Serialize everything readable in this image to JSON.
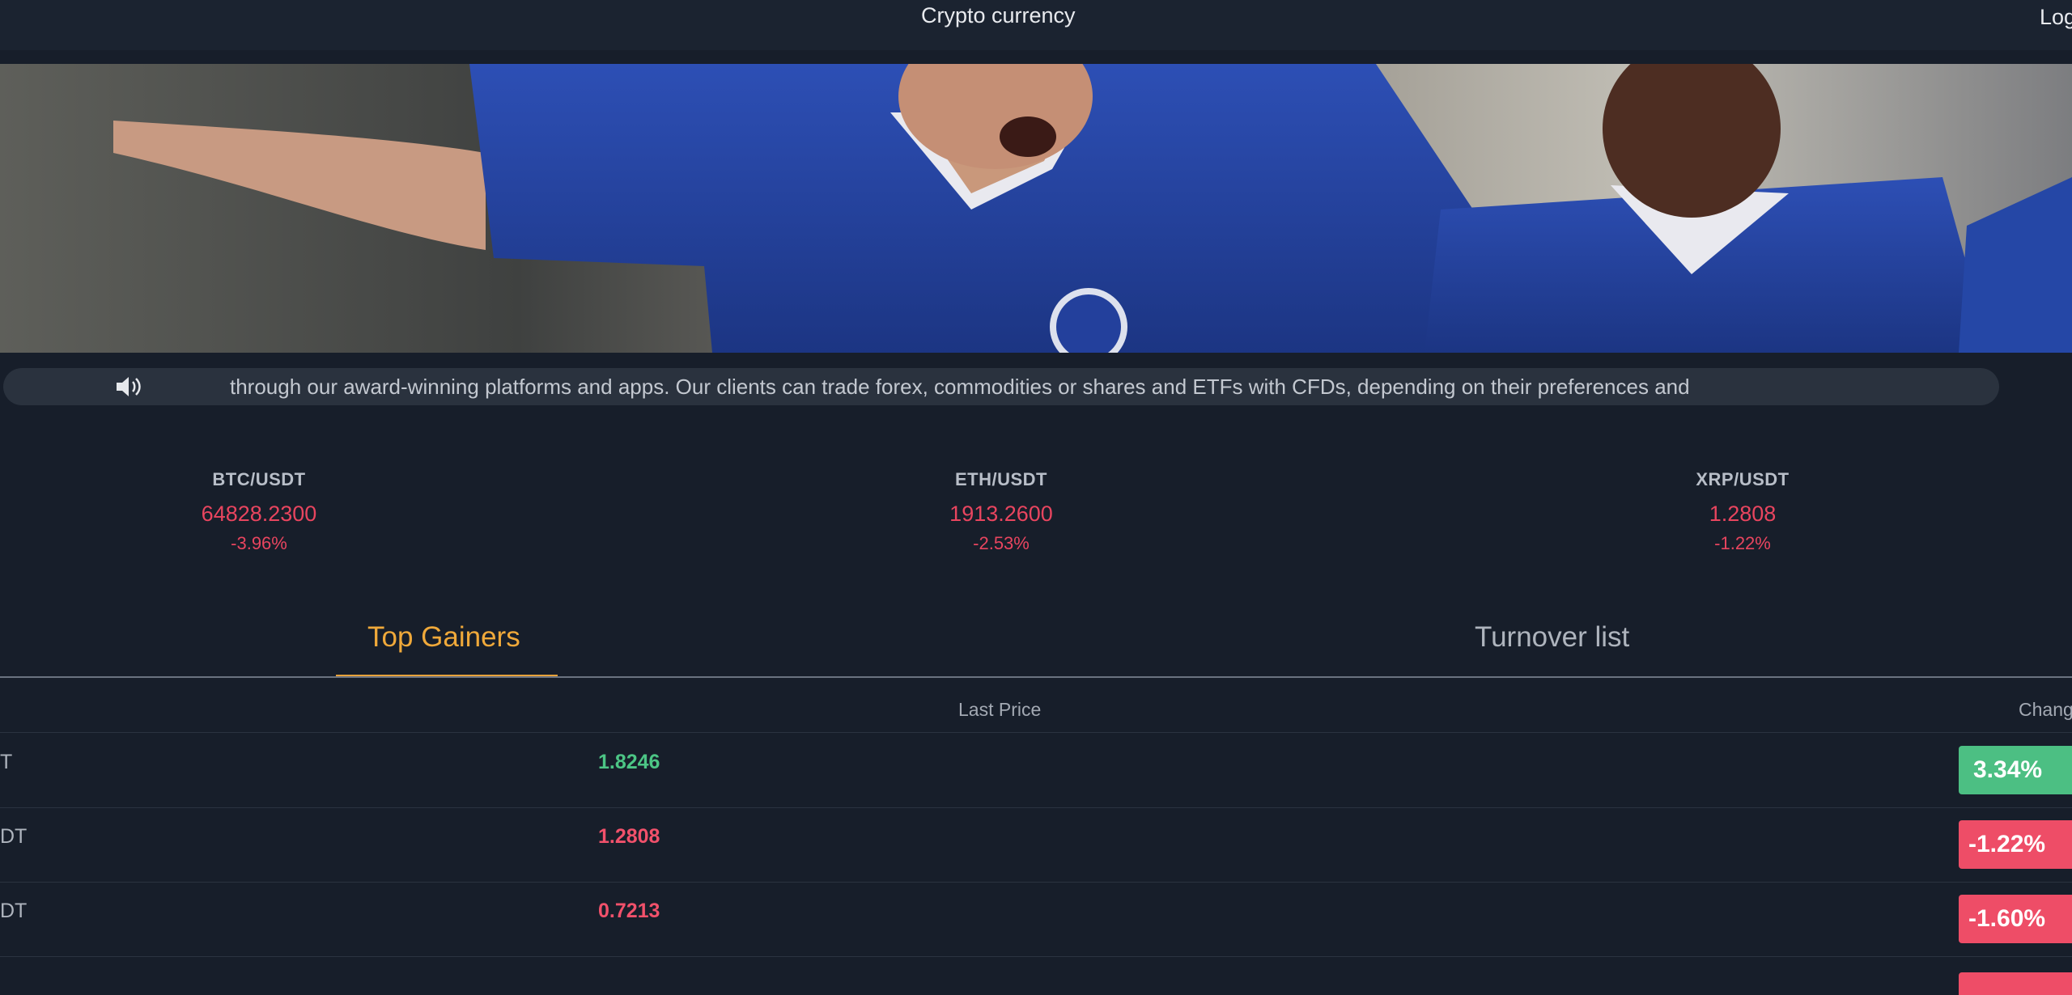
{
  "header": {
    "title": "Crypto currency",
    "login_label": "Log"
  },
  "notice": {
    "speaker_icon": "speaker-icon",
    "text": "through our award-winning platforms and apps. Our clients can trade forex, commodities or shares and ETFs with CFDs, depending on their preferences and"
  },
  "tickers": [
    {
      "pair": "BTC/USDT",
      "price": "64828.2300",
      "change": "-3.96%"
    },
    {
      "pair": "ETH/USDT",
      "price": "1913.2600",
      "change": "-2.53%"
    },
    {
      "pair": "XRP/USDT",
      "price": "1.2808",
      "change": "-1.22%"
    }
  ],
  "tabs": [
    {
      "label": "Top Gainers",
      "active": true
    },
    {
      "label": "Turnover list",
      "active": false
    }
  ],
  "table": {
    "headers": {
      "last_price": "Last Price",
      "change": "Chang"
    },
    "rows": [
      {
        "symbol": "T",
        "price": "1.8246",
        "change": "3.34%",
        "direction": "up"
      },
      {
        "symbol": "DT",
        "price": "1.2808",
        "change": "-1.22%",
        "direction": "down"
      },
      {
        "symbol": "DT",
        "price": "0.7213",
        "change": "-1.60%",
        "direction": "down"
      }
    ]
  },
  "colors": {
    "accent": "#f0a93a",
    "up": "#4cc585",
    "down": "#ee4d67",
    "background": "#171e2a"
  }
}
